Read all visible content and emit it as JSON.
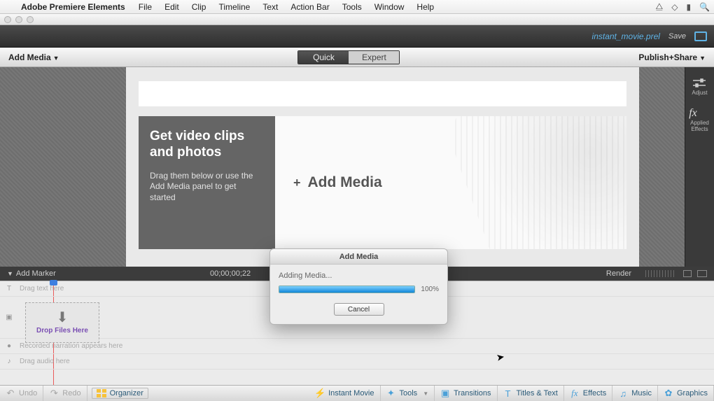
{
  "menubar": {
    "app": "Adobe Premiere Elements",
    "items": [
      "File",
      "Edit",
      "Clip",
      "Timeline",
      "Text",
      "Action Bar",
      "Tools",
      "Window",
      "Help"
    ]
  },
  "header": {
    "filename": "instant_movie.prel",
    "save": "Save"
  },
  "midbar": {
    "addmedia": "Add Media",
    "tab_quick": "Quick",
    "tab_expert": "Expert",
    "publish": "Publish+Share"
  },
  "hero": {
    "title": "Get video clips and photos",
    "subtitle": "Drag them below or use the Add Media panel to get started",
    "cta": "Add Media"
  },
  "right_panel": {
    "adjust": "Adjust",
    "fx_label": "Applied Effects",
    "fx_glyph": "fx"
  },
  "tl_head": {
    "addmarker": "Add Marker",
    "time": "00;00;00;22",
    "render": "Render"
  },
  "rows": {
    "text": "Drag text here",
    "narration": "Recorded narration appears here",
    "audio": "Drag audio here"
  },
  "drop": {
    "label": "Drop Files Here"
  },
  "bottom": {
    "undo": "Undo",
    "redo": "Redo",
    "organizer": "Organizer",
    "instant": "Instant Movie",
    "tools": "Tools",
    "transitions": "Transitions",
    "titles": "Titles & Text",
    "effects": "Effects",
    "music": "Music",
    "graphics": "Graphics"
  },
  "modal": {
    "title": "Add Media",
    "message": "Adding Media...",
    "percent": "100%",
    "cancel": "Cancel"
  }
}
